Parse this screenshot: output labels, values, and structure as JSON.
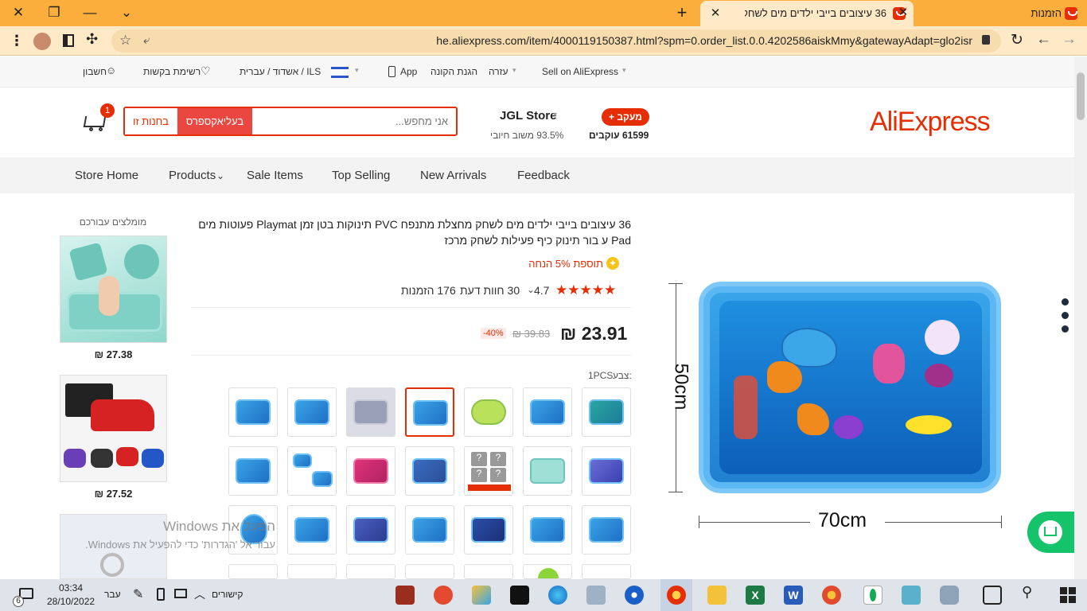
{
  "browser": {
    "tab_active_title": "36 עיצובים בייבי ילדים מים לשחק",
    "tab_other_title": "הזמנות",
    "url": "he.aliexpress.com/item/4000119150387.html?spm=0.order_list.0.0.4202586aiskMmy&gatewayAdapt=glo2isr"
  },
  "topstrip": {
    "sell": "Sell on AliExpress",
    "help": "עזרה",
    "buyer_protection": "הגנת הקונה",
    "app": "App",
    "region": "ILS / אשדוד / עברית",
    "wishlist": "רשימת בקשות",
    "account": "חשבון"
  },
  "header": {
    "logo": "AliExpress",
    "follow_button": "+ מעקב",
    "followers": "61599 עוקבים",
    "store_name": "JGL Store",
    "positive_feedback": "93.5% משוב חיובי",
    "search_placeholder": "אני מחפש...",
    "search_all": "בעליאקספרס",
    "search_store": "בחנות זו",
    "cart_count": "1"
  },
  "nav": {
    "items": [
      "Store Home",
      "Products",
      "Sale Items",
      "Top Selling",
      "New Arrivals",
      "Feedback"
    ]
  },
  "sidebar": {
    "title": "מומלצים עבורכם",
    "items": [
      {
        "price": "₪ 27.38"
      },
      {
        "price": "₪ 27.52"
      }
    ]
  },
  "product": {
    "title": "36 עיצובים בייבי ילדים מים לשחק מחצלת מתנפח PVC תינוקות בטן זמן Playmat פעוטות מים Pad ע בור תינוק כיף פעילות לשחק מרכז",
    "bonus": "תוספת 5% הנחה",
    "rating": "4.7",
    "reviews": "30 חוות דעת",
    "orders": "176 הזמנות",
    "price": "₪ 23.91",
    "old_price": "₪ 39.83",
    "discount": "-40%",
    "color_label": "צבע:",
    "color_value": "1PCS",
    "image_width_label": "70cm",
    "image_height_label": "50cm"
  },
  "overlay": {
    "activate_title": "הפעל את Windows",
    "activate_sub": "עבור אל 'הגדרות' כדי להפעיל את Windows."
  },
  "taskbar": {
    "time": "03:34",
    "date": "28/10/2022",
    "lang": "עבר",
    "links": "קישורים",
    "notif": "6"
  }
}
